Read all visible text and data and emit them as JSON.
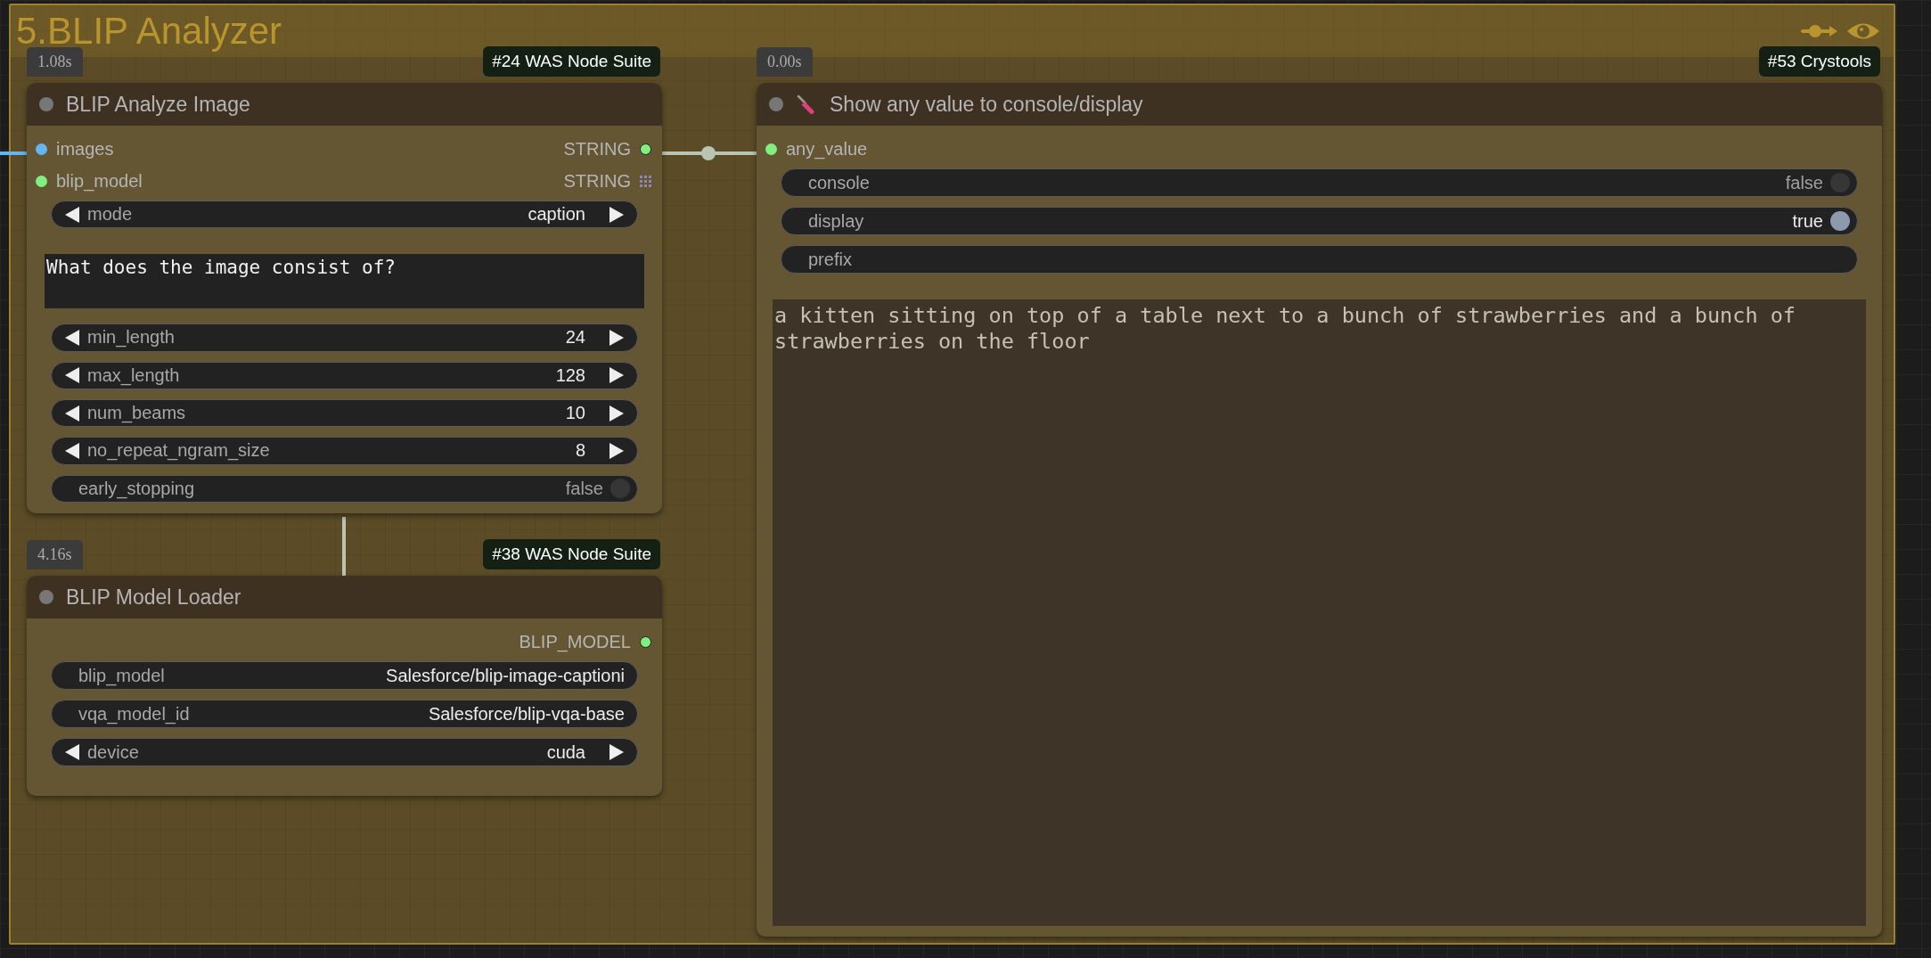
{
  "group": {
    "title": "5.BLIP Analyzer"
  },
  "nodes": [
    {
      "time": "1.08s",
      "tag": "#24 WAS Node Suite",
      "title": "BLIP Analyze Image",
      "title_icon": false,
      "slots": [
        {
          "input": {
            "name": "images",
            "color": "#64b5f6"
          },
          "output": {
            "name": "STRING",
            "kind": "dot",
            "color": "#7ff07f"
          }
        },
        {
          "input": {
            "name": "blip_model",
            "color": "#7ff07f"
          },
          "output": {
            "name": "STRING",
            "kind": "grid"
          }
        }
      ],
      "widgets": [
        {
          "kind": "combo",
          "label": "mode",
          "value": "caption"
        },
        {
          "kind": "textarea",
          "value": "What does the image consist of?"
        },
        {
          "kind": "combo",
          "label": "min_length",
          "value": "24"
        },
        {
          "kind": "combo",
          "label": "max_length",
          "value": "128"
        },
        {
          "kind": "combo",
          "label": "num_beams",
          "value": "10"
        },
        {
          "kind": "combo",
          "label": "no_repeat_ngram_size",
          "value": "8"
        },
        {
          "kind": "toggle",
          "label": "early_stopping",
          "value": "false",
          "on": false
        }
      ]
    },
    {
      "time": "4.16s",
      "tag": "#38 WAS Node Suite",
      "title": "BLIP Model Loader",
      "title_icon": false,
      "slots": [
        {
          "output": {
            "name": "BLIP_MODEL",
            "kind": "dot",
            "color": "#7ff07f"
          }
        }
      ],
      "widgets": [
        {
          "kind": "text",
          "label": "blip_model",
          "value": "Salesforce/blip-image-captioni"
        },
        {
          "kind": "text",
          "label": "vqa_model_id",
          "value": "Salesforce/blip-vqa-base"
        },
        {
          "kind": "combo",
          "label": "device",
          "value": "cuda"
        }
      ]
    },
    {
      "time": "0.00s",
      "tag": "#53 Crystools",
      "title": "Show any value to console/display",
      "title_icon": true,
      "slots": [
        {
          "input": {
            "name": "any_value",
            "color": "#7ff07f"
          }
        }
      ],
      "widgets": [
        {
          "kind": "toggle",
          "label": "console",
          "value": "false",
          "on": false
        },
        {
          "kind": "toggle",
          "label": "display",
          "value": "true",
          "on": true
        },
        {
          "kind": "text",
          "label": "prefix"
        },
        {
          "kind": "output",
          "value": "a kitten sitting on top of a table next to a bunch of strawberries and a bunch of strawberries on the floor"
        }
      ]
    }
  ]
}
